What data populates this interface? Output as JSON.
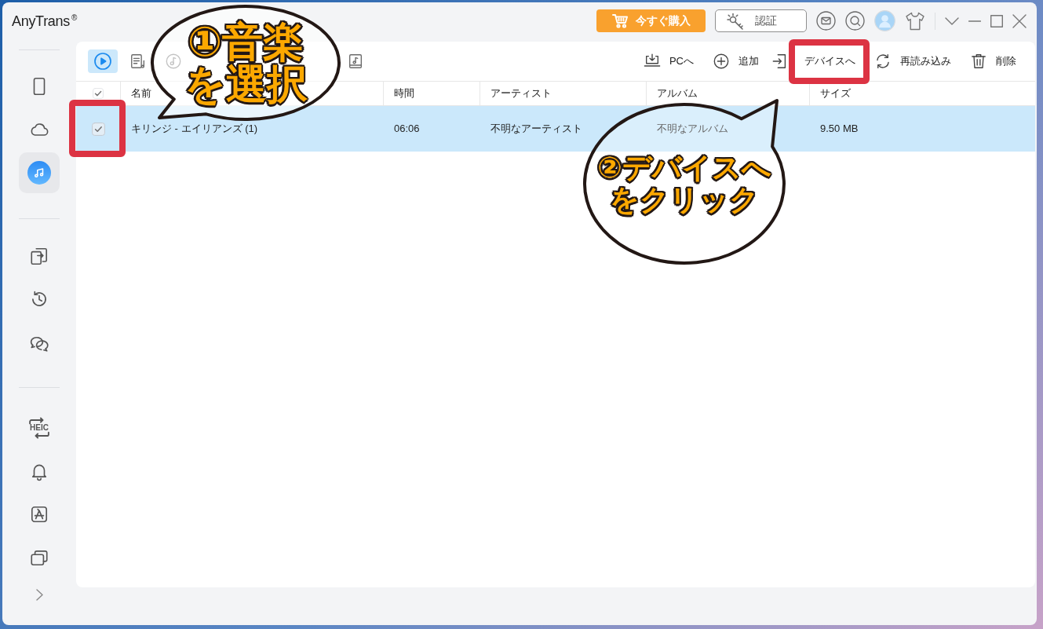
{
  "title_bar": {
    "app_name": "AnyTrans$^{®}$",
    "buy_button": "今すぐ購入",
    "activate_button": "認証"
  },
  "sidebar": {
    "groups": [
      {
        "items": [
          {
            "selected": false
          },
          {
            "selected": false
          },
          {
            "selected": true
          }
        ]
      },
      {
        "items": [
          {
            "selected": false
          },
          {
            "selected": false
          },
          {
            "selected": false
          }
        ]
      },
      {
        "items": [
          {
            "selected": false,
            "icon_text": "HEIC"
          },
          {
            "selected": false
          },
          {
            "selected": false
          },
          {
            "selected": false
          }
        ]
      }
    ]
  },
  "media_tabs": [
    {
      "selected": true
    },
    {
      "selected": false
    },
    {
      "selected": false
    },
    {
      "selected": false
    }
  ],
  "toolbar_actions": [
    {
      "label": "PCへ",
      "highlighted": false
    },
    {
      "label": "追加",
      "highlighted": false
    },
    {
      "label": "デバイスへ",
      "highlighted": true
    },
    {
      "label": "再読み込み",
      "highlighted": false
    },
    {
      "label": "削除",
      "highlighted": false
    }
  ],
  "table": {
    "select_all": {
      "checked": true
    },
    "columns": [
      "名前",
      "時間",
      "アーティスト",
      "アルバム",
      "サイズ"
    ],
    "rows": [
      {
        "selected": true,
        "checked": true,
        "highlighted": true,
        "cells": [
          "キリンジ - エイリアンズ (1)",
          "06:06",
          "不明なアーティスト",
          "不明なアルバム",
          "9.50 MB"
        ]
      }
    ]
  },
  "callouts": [
    {
      "lines": [
        "①音楽",
        "を選択"
      ]
    },
    {
      "lines": [
        "②デバイスへ",
        "をクリック"
      ]
    }
  ]
}
